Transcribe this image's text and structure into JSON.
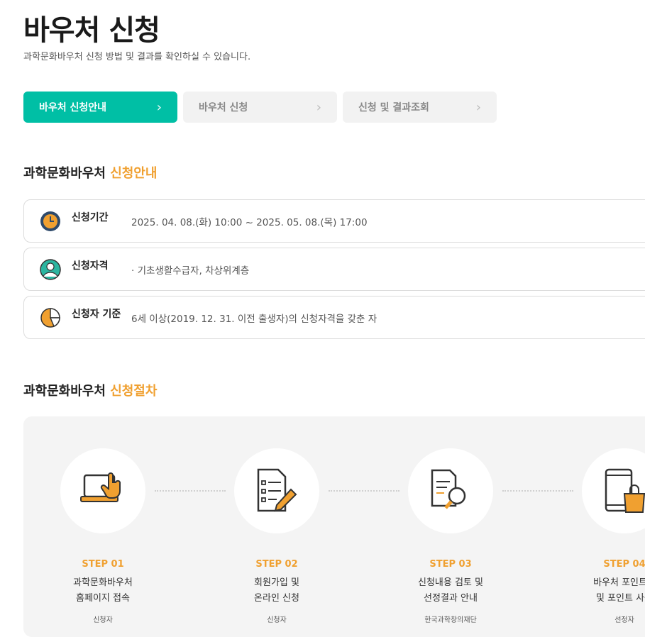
{
  "header": {
    "title": "바우처 신청",
    "subtitle": "과학문화바우처 신청 방법 및 결과를 확인하실 수 있습니다."
  },
  "tabs": [
    {
      "label": "바우처 신청안내",
      "active": true
    },
    {
      "label": "바우처 신청",
      "active": false
    },
    {
      "label": "신청 및 결과조회",
      "active": false
    }
  ],
  "guide_section": {
    "title_main": "과학문화바우처 ",
    "title_highlight": "신청안내",
    "rows": [
      {
        "icon": "clock-icon",
        "label": "신청기간",
        "value": "2025. 04. 08.(화) 10:00 ~ 2025. 05. 08.(목) 17:00"
      },
      {
        "icon": "user-icon",
        "label": "신청자격",
        "value": "· 기초생활수급자, 차상위계층"
      },
      {
        "icon": "pie-chart-icon",
        "label": "신청자 기준",
        "value": "6세 이상(2019. 12. 31. 이전 출생자)의 신청자격을 갖춘 자"
      }
    ]
  },
  "procedure_section": {
    "title_main": "과학문화바우처 ",
    "title_highlight": "신청절차",
    "steps": [
      {
        "num": "STEP 01",
        "desc": "과학문화바우처\n홈페이지 접속",
        "who": "신청자",
        "icon": "laptop-icon"
      },
      {
        "num": "STEP 02",
        "desc": "회원가입 및\n온라인 신청",
        "who": "신청자",
        "icon": "form-pencil-icon"
      },
      {
        "num": "STEP 03",
        "desc": "신청내용 검토 및\n선정결과 안내",
        "who": "한국과학창의재단",
        "icon": "document-search-icon"
      },
      {
        "num": "STEP 04",
        "desc": "바우처 포인트몰\n및 포인트 사용",
        "who": "선정자",
        "icon": "mobile-shopping-icon"
      }
    ]
  },
  "colors": {
    "accent": "#00bfa5",
    "highlight": "#f0a030",
    "icon_navy": "#2e4a6b"
  }
}
